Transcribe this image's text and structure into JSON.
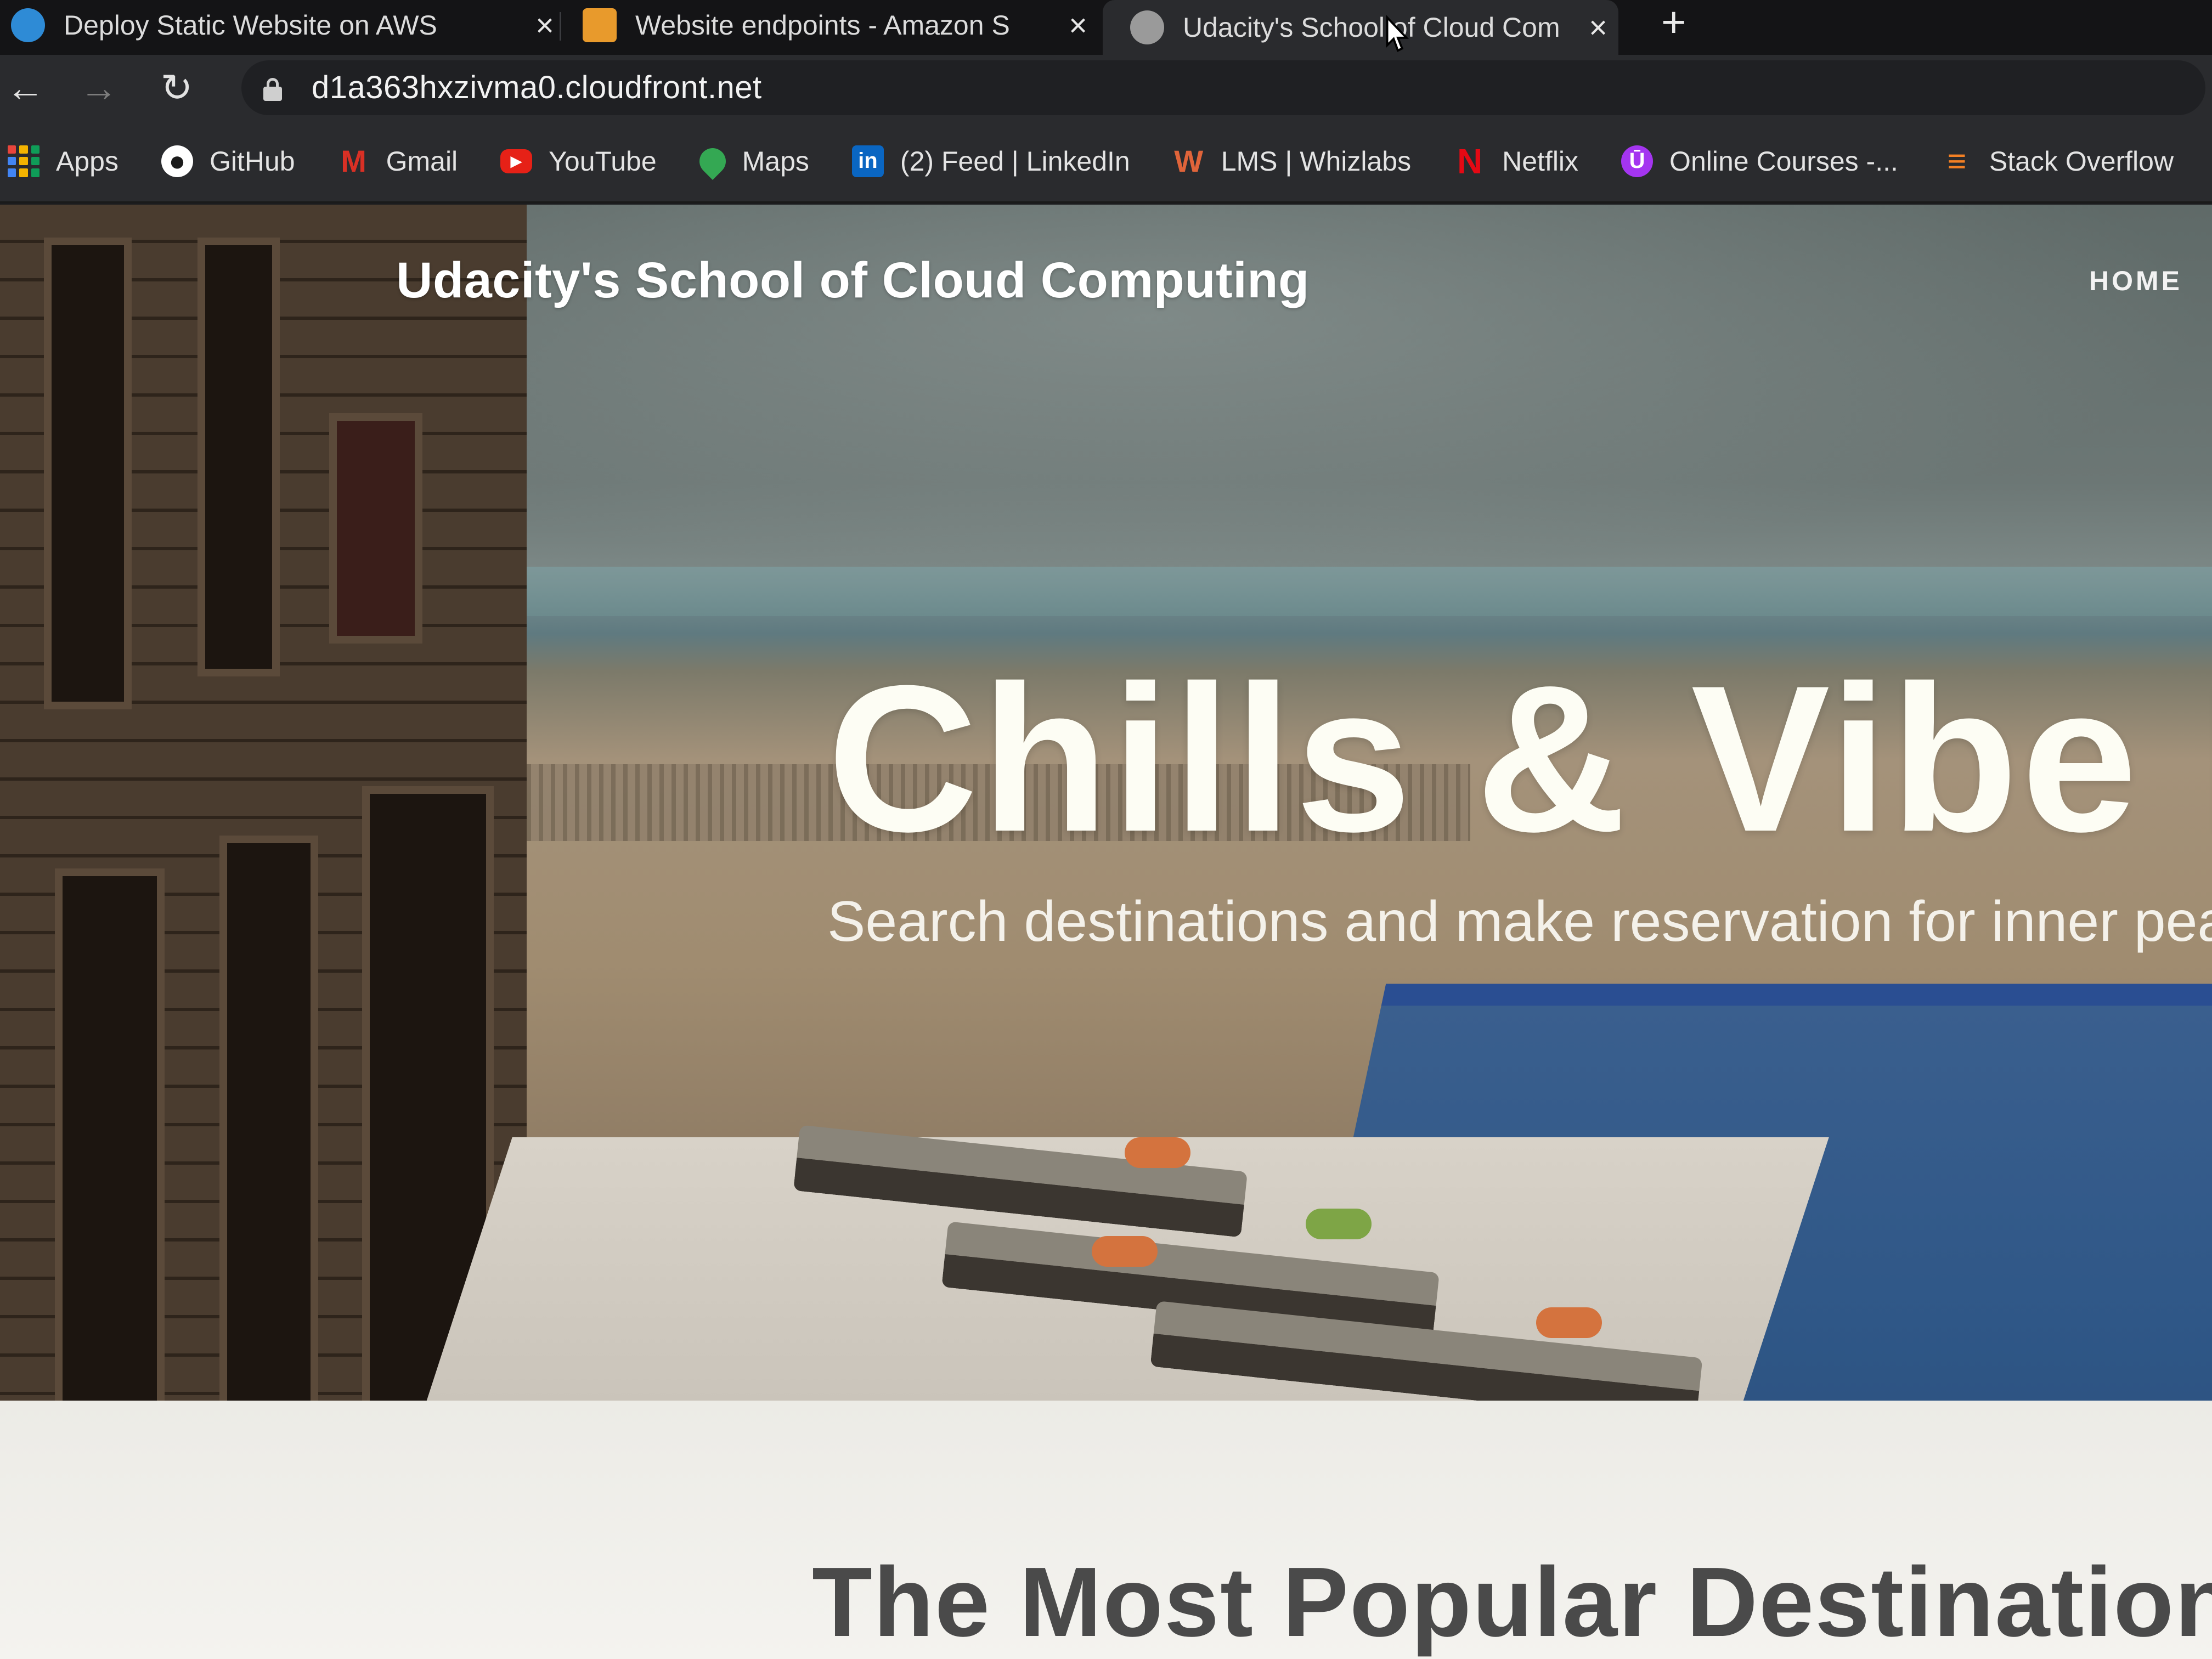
{
  "browser": {
    "tabs": [
      {
        "title": "Deploy Static Website on AWS",
        "favicon": "udacity-favicon-icon",
        "color": "#2e8bd6",
        "active": false
      },
      {
        "title": "Website endpoints - Amazon S",
        "favicon": "aws-docs-favicon-icon",
        "color": "#e89a2c",
        "active": false
      },
      {
        "title": "Udacity's School of Cloud Com",
        "favicon": "globe-favicon-icon",
        "color": "#9a9a9a",
        "active": true
      }
    ],
    "new_tab_symbol": "+",
    "close_symbol": "×",
    "nav": {
      "back": "←",
      "forward": "→",
      "reload": "↻"
    },
    "url": "d1a363hxzivma0.cloudfront.net",
    "bookmarks": [
      {
        "label": "Apps",
        "icon": "apps-grid-icon"
      },
      {
        "label": "GitHub",
        "icon": "github-icon",
        "glyph": "●",
        "color": "#1b1b1b",
        "fg": "#ffffff"
      },
      {
        "label": "Gmail",
        "icon": "gmail-icon",
        "glyph": "M",
        "color": "#ffffff",
        "fg": "#d93025"
      },
      {
        "label": "YouTube",
        "icon": "youtube-icon",
        "glyph": "▶",
        "color": "#e62117",
        "fg": "#ffffff"
      },
      {
        "label": "Maps",
        "icon": "maps-pin-icon",
        "glyph": "⬤",
        "color": "#34a853",
        "fg": "#fbbc05"
      },
      {
        "label": "(2) Feed | LinkedIn",
        "icon": "linkedin-icon",
        "glyph": "in",
        "color": "#0a66c2",
        "fg": "#ffffff"
      },
      {
        "label": "LMS | Whizlabs",
        "icon": "whizlabs-icon",
        "glyph": "W",
        "color": "#2a2b2e",
        "fg": "#e0643a"
      },
      {
        "label": "Netflix",
        "icon": "netflix-icon",
        "glyph": "N",
        "color": "#2a2b2e",
        "fg": "#e50914"
      },
      {
        "label": "Online Courses -...",
        "icon": "udemy-icon",
        "glyph": "Ū",
        "color": "#a435f0",
        "fg": "#ffffff"
      },
      {
        "label": "Stack Overflow",
        "icon": "stackoverflow-icon",
        "glyph": "≡",
        "color": "#2a2b2e",
        "fg": "#f48024"
      }
    ]
  },
  "site": {
    "title": "Udacity's School of Cloud Computing",
    "nav_home": "HOME",
    "hero_heading": "Chills & Vibe Bl",
    "hero_subheading": "Search destinations and make reservation for inner peace",
    "section_heading": "The Most Popular Destinations for"
  }
}
